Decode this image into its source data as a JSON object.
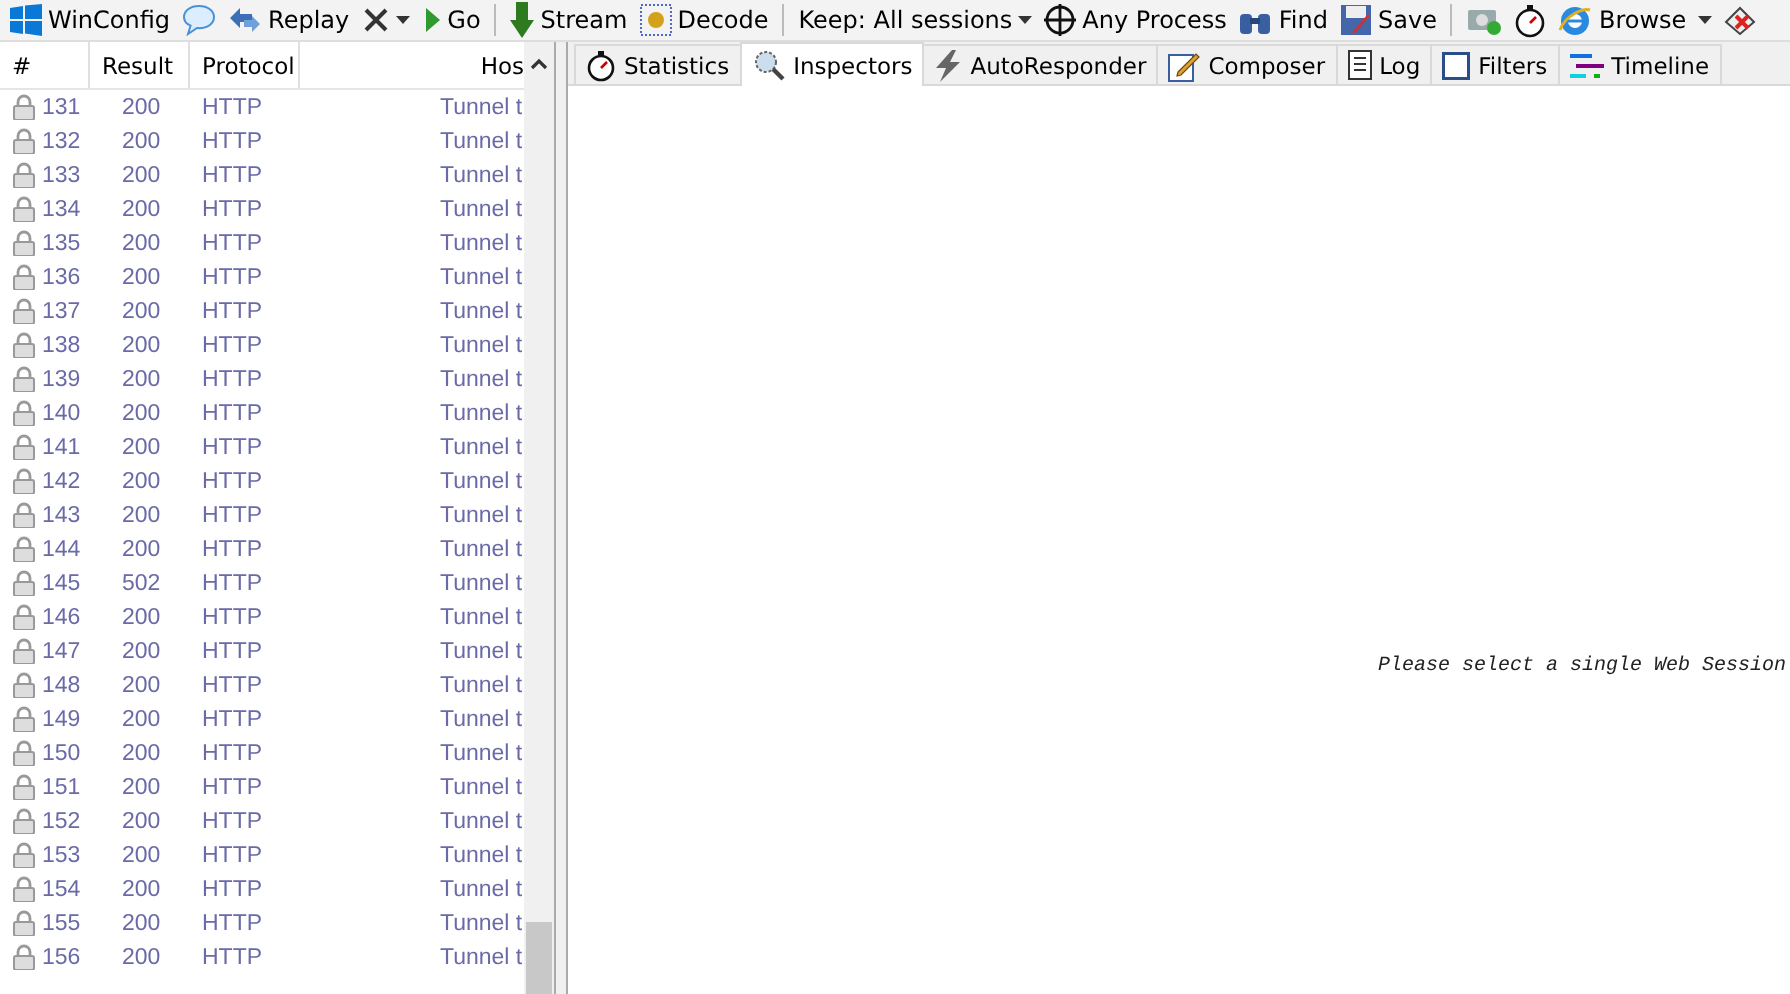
{
  "toolbar": [
    [
      {
        "kind": "windows",
        "label": "WinConfig"
      },
      {
        "kind": "bubble"
      },
      {
        "kind": "replay",
        "label": "Replay"
      },
      {
        "kind": "remove",
        "menu": true
      },
      {
        "kind": "go",
        "label": "Go"
      }
    ],
    [
      {
        "kind": "stream",
        "label": "Stream"
      },
      {
        "kind": "decode",
        "label": "Decode"
      }
    ],
    [
      {
        "kind": "plain",
        "label": "Keep: All sessions",
        "menu": true
      },
      {
        "kind": "target",
        "label": "Any Process"
      },
      {
        "kind": "find",
        "label": "Find"
      },
      {
        "kind": "save",
        "label": "Save"
      }
    ],
    [
      {
        "kind": "camera"
      },
      {
        "kind": "timer"
      },
      {
        "kind": "browse",
        "label": "Browse"
      },
      {
        "kind": "plain",
        "menu": true
      },
      {
        "kind": "clear"
      }
    ]
  ],
  "sessions": {
    "columns": [
      "#",
      "Result",
      "Protocol",
      "Hos"
    ],
    "rows": [
      {
        "id": "131",
        "result": "200",
        "protocol": "HTTP",
        "host": "Tunnel t"
      },
      {
        "id": "132",
        "result": "200",
        "protocol": "HTTP",
        "host": "Tunnel t"
      },
      {
        "id": "133",
        "result": "200",
        "protocol": "HTTP",
        "host": "Tunnel t"
      },
      {
        "id": "134",
        "result": "200",
        "protocol": "HTTP",
        "host": "Tunnel t"
      },
      {
        "id": "135",
        "result": "200",
        "protocol": "HTTP",
        "host": "Tunnel t"
      },
      {
        "id": "136",
        "result": "200",
        "protocol": "HTTP",
        "host": "Tunnel t"
      },
      {
        "id": "137",
        "result": "200",
        "protocol": "HTTP",
        "host": "Tunnel t"
      },
      {
        "id": "138",
        "result": "200",
        "protocol": "HTTP",
        "host": "Tunnel t"
      },
      {
        "id": "139",
        "result": "200",
        "protocol": "HTTP",
        "host": "Tunnel t"
      },
      {
        "id": "140",
        "result": "200",
        "protocol": "HTTP",
        "host": "Tunnel t"
      },
      {
        "id": "141",
        "result": "200",
        "protocol": "HTTP",
        "host": "Tunnel t"
      },
      {
        "id": "142",
        "result": "200",
        "protocol": "HTTP",
        "host": "Tunnel t"
      },
      {
        "id": "143",
        "result": "200",
        "protocol": "HTTP",
        "host": "Tunnel t"
      },
      {
        "id": "144",
        "result": "200",
        "protocol": "HTTP",
        "host": "Tunnel t"
      },
      {
        "id": "145",
        "result": "502",
        "protocol": "HTTP",
        "host": "Tunnel t"
      },
      {
        "id": "146",
        "result": "200",
        "protocol": "HTTP",
        "host": "Tunnel t"
      },
      {
        "id": "147",
        "result": "200",
        "protocol": "HTTP",
        "host": "Tunnel t"
      },
      {
        "id": "148",
        "result": "200",
        "protocol": "HTTP",
        "host": "Tunnel t"
      },
      {
        "id": "149",
        "result": "200",
        "protocol": "HTTP",
        "host": "Tunnel t"
      },
      {
        "id": "150",
        "result": "200",
        "protocol": "HTTP",
        "host": "Tunnel t"
      },
      {
        "id": "151",
        "result": "200",
        "protocol": "HTTP",
        "host": "Tunnel t"
      },
      {
        "id": "152",
        "result": "200",
        "protocol": "HTTP",
        "host": "Tunnel t"
      },
      {
        "id": "153",
        "result": "200",
        "protocol": "HTTP",
        "host": "Tunnel t"
      },
      {
        "id": "154",
        "result": "200",
        "protocol": "HTTP",
        "host": "Tunnel t"
      },
      {
        "id": "155",
        "result": "200",
        "protocol": "HTTP",
        "host": "Tunnel t"
      },
      {
        "id": "156",
        "result": "200",
        "protocol": "HTTP",
        "host": "Tunnel t"
      }
    ]
  },
  "tabs": [
    {
      "kind": "stopwatch",
      "label": "Statistics",
      "selected": false
    },
    {
      "kind": "magnifier",
      "label": "Inspectors",
      "selected": true
    },
    {
      "kind": "bolt",
      "label": "AutoResponder",
      "selected": false
    },
    {
      "kind": "pencil",
      "label": "Composer",
      "selected": false
    },
    {
      "kind": "page",
      "label": "Log",
      "selected": false
    },
    {
      "kind": "square",
      "label": "Filters",
      "selected": false
    },
    {
      "kind": "lines",
      "label": "Timeline",
      "selected": false
    }
  ],
  "message": "Please select a single Web Session"
}
